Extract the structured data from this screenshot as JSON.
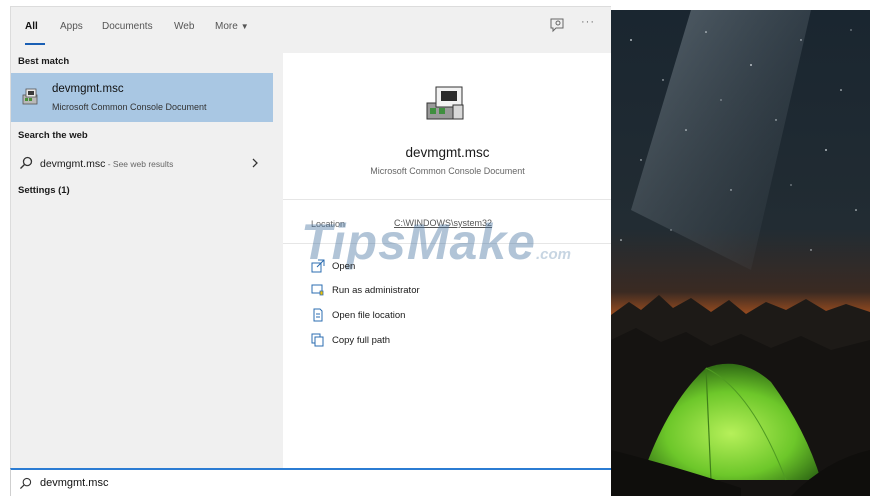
{
  "tabs": [
    {
      "label": "All",
      "active": true
    },
    {
      "label": "Apps",
      "active": false
    },
    {
      "label": "Documents",
      "active": false
    },
    {
      "label": "Web",
      "active": false
    },
    {
      "label": "More",
      "active": false
    }
  ],
  "toolbar": {
    "more_options_glyph": "···"
  },
  "sections": {
    "best_match": "Best match",
    "search_web": "Search the web",
    "settings": "Settings (1)"
  },
  "best_match": {
    "title": "devmgmt.msc",
    "subtitle": "Microsoft Common Console Document"
  },
  "web_result": {
    "query": "devmgmt.msc",
    "suffix": " - See web results"
  },
  "details": {
    "title": "devmgmt.msc",
    "subtitle": "Microsoft Common Console Document",
    "location_label": "Location",
    "location_value": "C:\\WINDOWS\\system32",
    "actions": [
      {
        "label": "Open",
        "icon": "open-icon"
      },
      {
        "label": "Run as administrator",
        "icon": "run-as-admin-icon"
      },
      {
        "label": "Open file location",
        "icon": "file-location-icon"
      },
      {
        "label": "Copy full path",
        "icon": "copy-path-icon"
      }
    ]
  },
  "watermark": {
    "main": "TipsMake",
    "sub": ".com"
  },
  "search": {
    "value": "devmgmt.msc",
    "placeholder": ""
  },
  "colors": {
    "accent": "#2b7cd3",
    "selection": "#a9c7e3",
    "panel": "#f0f0f0",
    "tent": "#7ed321"
  }
}
